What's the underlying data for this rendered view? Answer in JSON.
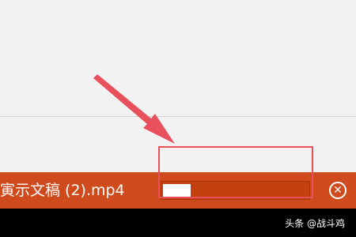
{
  "download_bar": {
    "file_name": "寅示文稿 (2).mp4",
    "progress_fraction": 0.19,
    "close_icon": "close-circle-icon",
    "close_glyph": "✕"
  },
  "watermark": {
    "text": "头条 @战斗鸡"
  },
  "colors": {
    "bar": "#cf4a1c",
    "progress_track": "#c2410f",
    "progress_fill": "#ffffff",
    "annotation": "#e8505b",
    "background": "#f2f2f2",
    "bottom_strip": "#000000"
  }
}
